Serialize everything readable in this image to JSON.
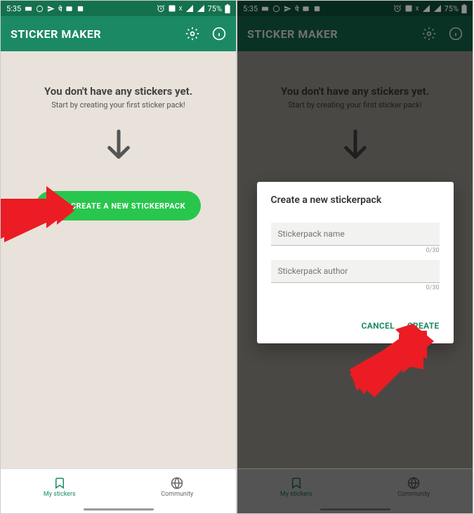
{
  "status": {
    "time": "5:35",
    "battery": "75%",
    "signal_x": "X"
  },
  "app_bar": {
    "title": "STICKER MAKER"
  },
  "empty": {
    "title": "You don't have any stickers yet.",
    "subtitle": "Start by creating your first sticker pack!"
  },
  "create_button": "CREATE A NEW STICKERPACK",
  "nav": {
    "my_stickers": "My stickers",
    "community": "Community"
  },
  "dialog": {
    "title": "Create a new stickerpack",
    "name_placeholder": "Stickerpack name",
    "author_placeholder": "Stickerpack author",
    "counter": "0/30",
    "cancel": "CANCEL",
    "create": "CREATE"
  }
}
